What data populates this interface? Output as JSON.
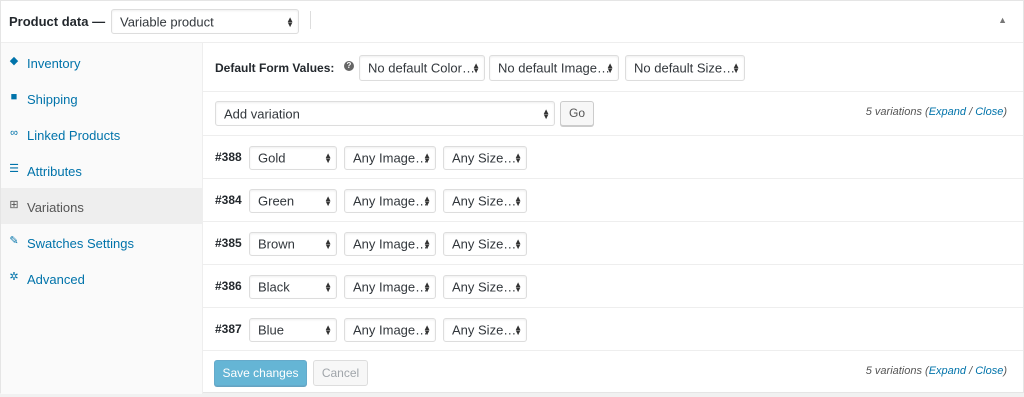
{
  "header": {
    "title": "Product data —",
    "product_type": "Variable product"
  },
  "sidebar": {
    "items": [
      {
        "label": "Inventory",
        "icon": "inventory-icon"
      },
      {
        "label": "Shipping",
        "icon": "truck-icon"
      },
      {
        "label": "Linked Products",
        "icon": "link-icon"
      },
      {
        "label": "Attributes",
        "icon": "list-icon"
      },
      {
        "label": "Variations",
        "icon": "grid-icon"
      },
      {
        "label": "Swatches Settings",
        "icon": "wrench-icon"
      },
      {
        "label": "Advanced",
        "icon": "gear-icon"
      }
    ],
    "active": "Variations"
  },
  "defaults": {
    "label": "Default Form Values:",
    "color": "No default Color…",
    "image": "No default Image…",
    "size": "No default Size…"
  },
  "toolbar": {
    "bulk_action": "Add variation",
    "go_label": "Go"
  },
  "count_top": {
    "text": "5 variations (",
    "expand": "Expand",
    "slash": " / ",
    "close": "Close",
    "end": ")"
  },
  "variations": [
    {
      "id": "#388",
      "color": "Gold",
      "image": "Any Image…",
      "size": "Any Size…"
    },
    {
      "id": "#384",
      "color": "Green",
      "image": "Any Image…",
      "size": "Any Size…"
    },
    {
      "id": "#385",
      "color": "Brown",
      "image": "Any Image…",
      "size": "Any Size…"
    },
    {
      "id": "#386",
      "color": "Black",
      "image": "Any Image…",
      "size": "Any Size…"
    },
    {
      "id": "#387",
      "color": "Blue",
      "image": "Any Image…",
      "size": "Any Size…"
    }
  ],
  "footer": {
    "save_label": "Save changes",
    "cancel_label": "Cancel"
  },
  "count_bottom": {
    "text": "5 variations (",
    "expand": "Expand",
    "slash": " / ",
    "close": "Close",
    "end": ")"
  },
  "colors": {
    "link": "#0073aa",
    "primary": "#0085ba"
  }
}
